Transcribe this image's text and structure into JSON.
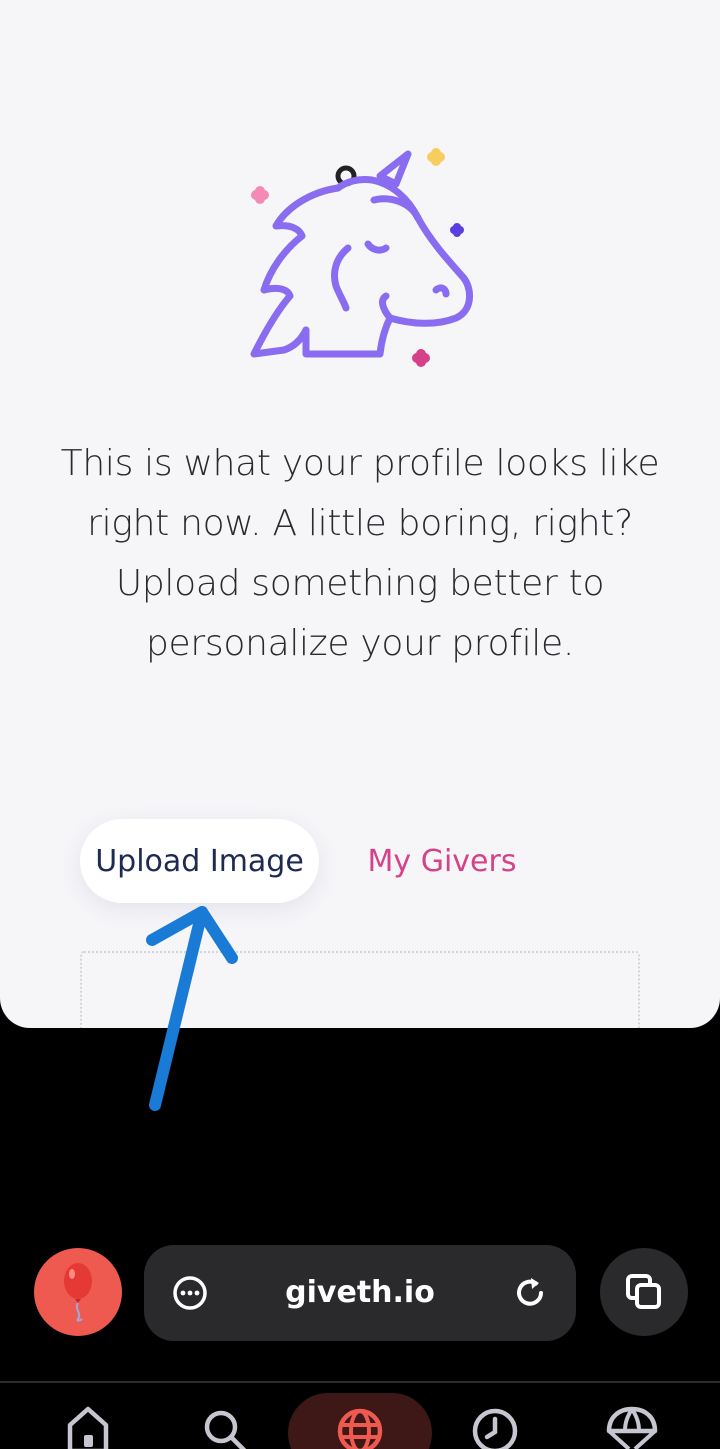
{
  "profile": {
    "message": "This is what your profile looks like right now. A little boring, right? Upload something better to personalize your profile.",
    "upload_label": "Upload Image",
    "givers_label": "My Givers"
  },
  "browser": {
    "url": "giveth.io"
  },
  "colors": {
    "accent": "#d6418a",
    "unicorn": "#8a6cf0",
    "annotation_arrow": "#1a7bd6",
    "active_nav": "#ee5a4f"
  },
  "icons": {
    "menu": "more-options-icon",
    "reload": "reload-icon",
    "tabs": "tabs-icon",
    "balloon": "balloon-icon"
  }
}
